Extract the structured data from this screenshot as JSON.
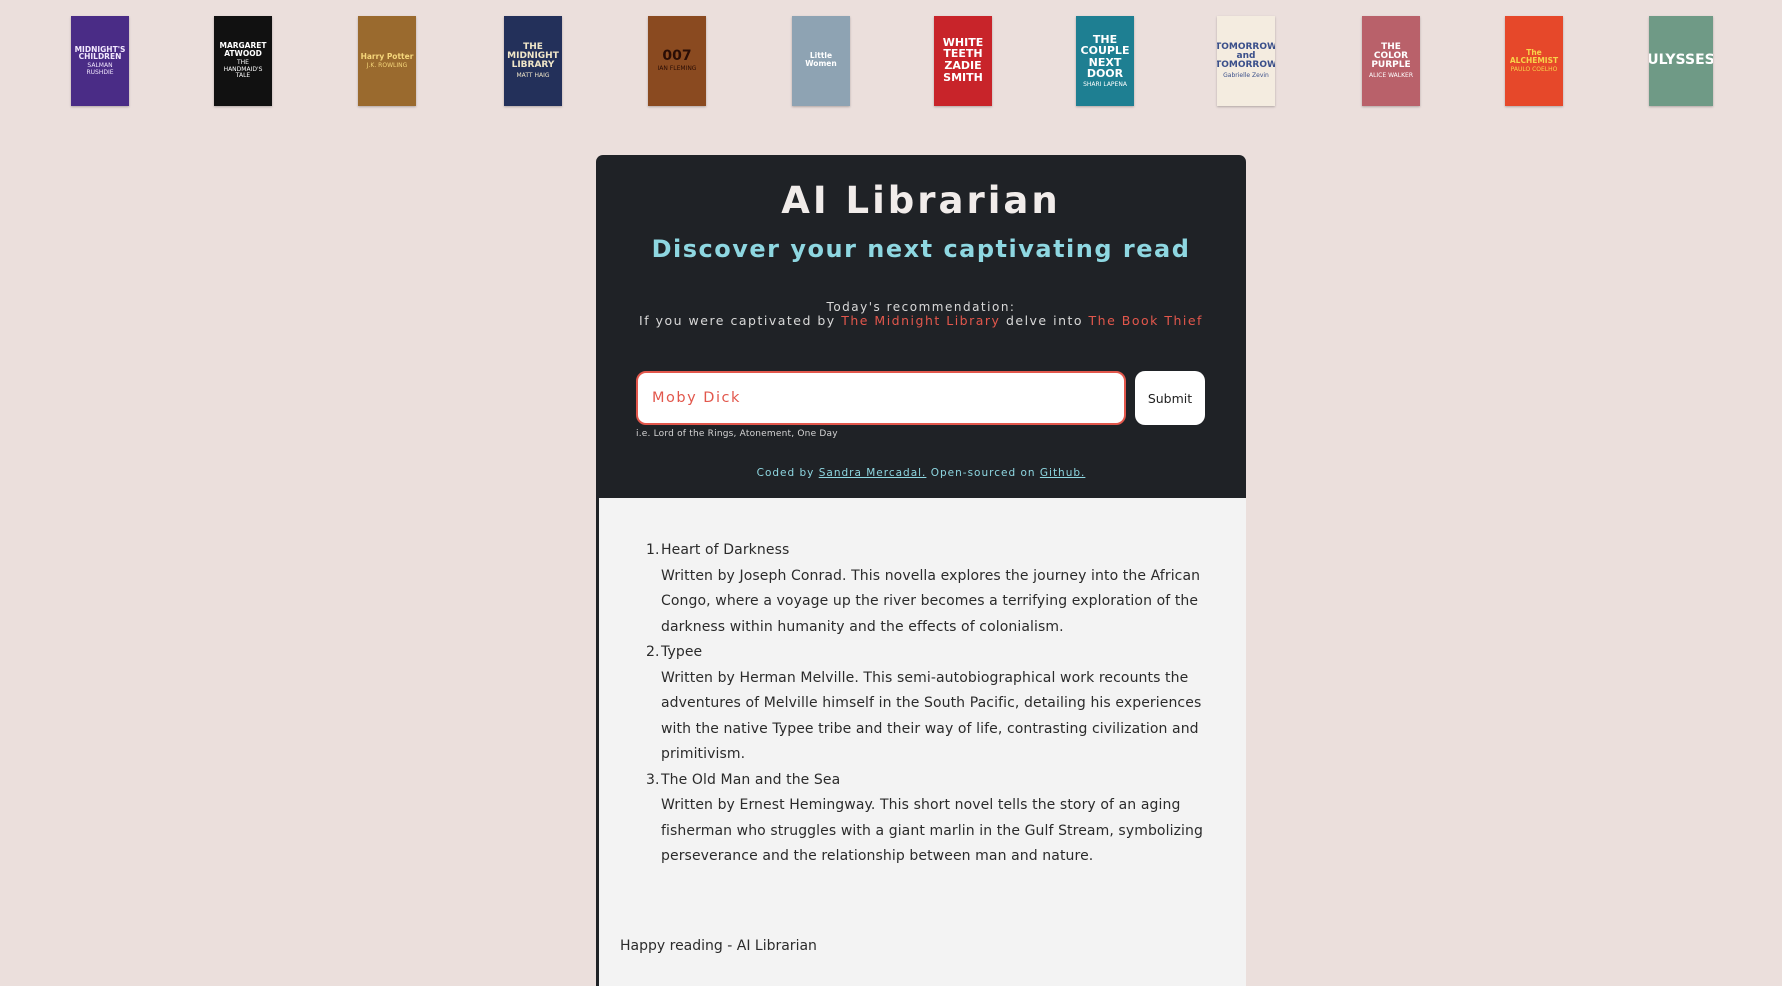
{
  "covers": [
    {
      "title": "MIDNIGHT'S\nCHILDREN",
      "author": "SALMAN RUSHDIE",
      "bg": "#4a2c86",
      "fg": "#f3e9ff"
    },
    {
      "title": "MARGARET\nATWOOD",
      "author": "THE\nHANDMAID'S\nTALE",
      "bg": "#111111",
      "fg": "#ffffff"
    },
    {
      "title": "Harry Potter",
      "author": "J.K. ROWLING",
      "bg": "#9a6a2e",
      "fg": "#f5d67a"
    },
    {
      "title": "THE\nMIDNIGHT\nLIBRARY",
      "author": "MATT HAIG",
      "bg": "#23305a",
      "fg": "#f0e6c8"
    },
    {
      "title": "007",
      "author": "IAN FLEMING",
      "bg": "#8a4a20",
      "fg": "#2a0d05"
    },
    {
      "title": "Little\nWomen",
      "author": "",
      "bg": "#8ea3b3",
      "fg": "#ffffff"
    },
    {
      "title": "WHITE\nTEETH\nZADIE\nSMITH",
      "author": "",
      "bg": "#c8242a",
      "fg": "#ffffff"
    },
    {
      "title": "THE\nCOUPLE\nNEXT\nDOOR",
      "author": "SHARI LAPENA",
      "bg": "#1e7f92",
      "fg": "#ffffff"
    },
    {
      "title": "TOMORROW\nand\nTOMORROW",
      "author": "Gabrielle Zevin",
      "bg": "#f4ece0",
      "fg": "#3a4f8a"
    },
    {
      "title": "THE\nCOLOR\nPURPLE",
      "author": "ALICE WALKER",
      "bg": "#b9616a",
      "fg": "#ffffff"
    },
    {
      "title": "The\nALCHEMIST",
      "author": "PAULO COELHO",
      "bg": "#e6482a",
      "fg": "#f8d34a"
    },
    {
      "title": "ULYSSES",
      "author": "",
      "bg": "#6f9a86",
      "fg": "#ffffff"
    }
  ],
  "header": {
    "title": "AI Librarian",
    "subtitle": "Discover your next captivating read"
  },
  "recommendation": {
    "label": "Today's recommendation:",
    "prefix": "If you were captivated by",
    "book1": "The Midnight Library",
    "middle": "delve into",
    "book2": "The Book Thief"
  },
  "search": {
    "placeholder": "Moby Dick",
    "submit_label": "Submit",
    "hint": "i.e. Lord of the Rings, Atonement, One Day"
  },
  "credit": {
    "coded_by": "Coded by",
    "author_link": "Sandra Mercadal.",
    "open_sourced": "Open-sourced on",
    "github_link": "Github."
  },
  "results": [
    {
      "num": "1.",
      "title": "Heart of Darkness",
      "description": "Written by Joseph Conrad. This novella explores the journey into the African Congo, where a voyage up the river becomes a terrifying exploration of the darkness within humanity and the effects of colonialism."
    },
    {
      "num": "2.",
      "title": "Typee",
      "description": "Written by Herman Melville. This semi-autobiographical work recounts the adventures of Melville himself in the South Pacific, detailing his experiences with the native Typee tribe and their way of life, contrasting civilization and primitivism."
    },
    {
      "num": "3.",
      "title": "The Old Man and the Sea",
      "description": "Written by Ernest Hemingway. This short novel tells the story of an aging fisherman who struggles with a giant marlin in the Gulf Stream, symbolizing perseverance and the relationship between man and nature."
    }
  ],
  "signoff": "Happy reading - AI Librarian",
  "colors": {
    "background": "#ebdfdc",
    "panel": "#1f2226",
    "accent_teal": "#8ed7e1",
    "accent_red": "#e2574c"
  }
}
